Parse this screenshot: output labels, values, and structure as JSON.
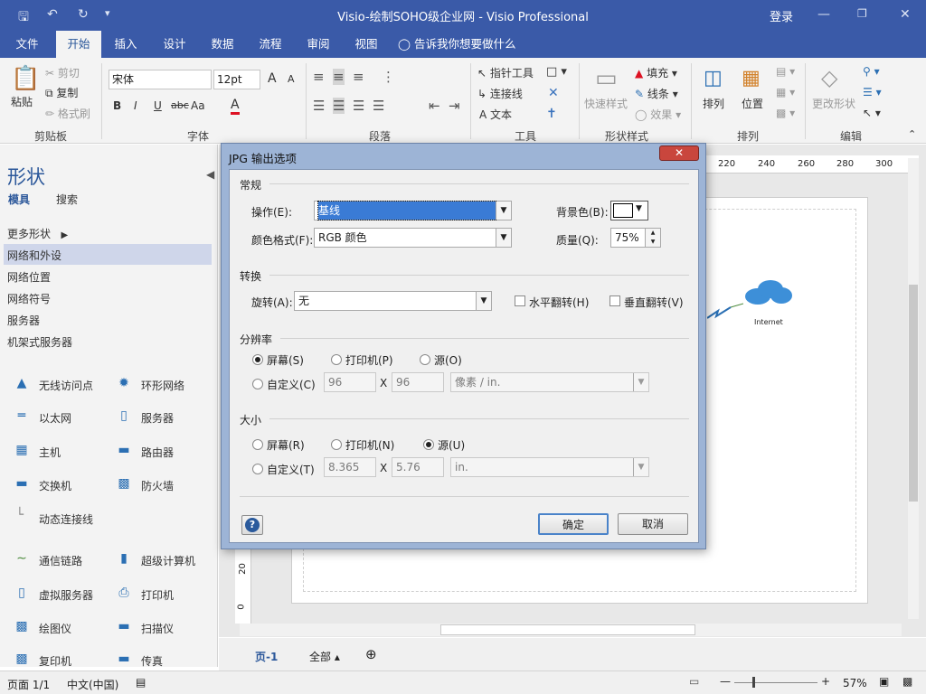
{
  "window": {
    "title": "Visio-绘制SOHO级企业网 - Visio Professional",
    "signin": "登录"
  },
  "tabs": [
    "文件",
    "开始",
    "插入",
    "设计",
    "数据",
    "流程",
    "审阅",
    "视图"
  ],
  "tell_me": "告诉我你想要做什么",
  "ribbon": {
    "clipboard": {
      "paste": "粘贴",
      "cut": "剪切",
      "copy": "复制",
      "format_painter": "格式刷",
      "group": "剪贴板"
    },
    "font": {
      "family": "宋体",
      "size": "12pt",
      "group": "字体",
      "bold": "B",
      "italic": "I",
      "underline": "U",
      "strike": "abc",
      "case": "Aa",
      "color": "A",
      "grow": "A",
      "shrink": "A"
    },
    "paragraph": {
      "group": "段落"
    },
    "tools": {
      "pointer": "指针工具",
      "connector": "连接线",
      "text": "文本",
      "group": "工具"
    },
    "shape_styles": {
      "quick_styles": "快速样式",
      "fill": "填充",
      "line": "线条",
      "effects": "效果",
      "group": "形状样式"
    },
    "arrange": {
      "arrange": "排列",
      "position": "位置",
      "group": "排列"
    },
    "editing": {
      "change_shape": "更改形状",
      "group": "编辑"
    }
  },
  "shapes_pane": {
    "title": "形状",
    "tabs": [
      "模具",
      "搜索"
    ],
    "more": "更多形状",
    "stencils": [
      "网络和外设",
      "网络位置",
      "网络符号",
      "服务器",
      "机架式服务器"
    ],
    "shapes": [
      [
        "无线访问点",
        "环形网络"
      ],
      [
        "以太网",
        "服务器"
      ],
      [
        "主机",
        "路由器"
      ],
      [
        "交换机",
        "防火墙"
      ],
      [
        "动态连接线",
        ""
      ],
      [
        "通信链路",
        "超级计算机"
      ],
      [
        "虚拟服务器",
        "打印机"
      ],
      [
        "绘图仪",
        "扫描仪"
      ],
      [
        "复印机",
        "传真"
      ]
    ]
  },
  "ruler": [
    "220",
    "240",
    "260",
    "280",
    "300"
  ],
  "vruler": [
    "20",
    "0"
  ],
  "canvas": {
    "cloud_label": "Internet"
  },
  "page_tabs": {
    "page": "页-1",
    "all": "全部"
  },
  "status": {
    "page": "页面 1/1",
    "lang": "中文(中国)",
    "zoom": "57%"
  },
  "dialog": {
    "title": "JPG 输出选项",
    "general": "常规",
    "operation_label": "操作(E):",
    "operation_value": "基线",
    "bgcolor_label": "背景色(B):",
    "colorfmt_label": "颜色格式(F):",
    "colorfmt_value": "RGB 颜色",
    "quality_label": "质量(Q):",
    "quality_value": "75%",
    "transform": "转换",
    "rotate_label": "旋转(A):",
    "rotate_value": "无",
    "flip_h": "水平翻转(H)",
    "flip_v": "垂直翻转(V)",
    "resolution": "分辨率",
    "res_screen": "屏幕(S)",
    "res_printer": "打印机(P)",
    "res_source": "源(O)",
    "res_custom": "自定义(C)",
    "res_w": "96",
    "res_h": "96",
    "res_unit": "像素 / in.",
    "size": "大小",
    "size_screen": "屏幕(R)",
    "size_printer": "打印机(N)",
    "size_source": "源(U)",
    "size_custom": "自定义(T)",
    "size_w": "8.365",
    "size_h": "5.76",
    "size_unit": "in.",
    "x": "X",
    "ok": "确定",
    "cancel": "取消",
    "help": "?"
  }
}
